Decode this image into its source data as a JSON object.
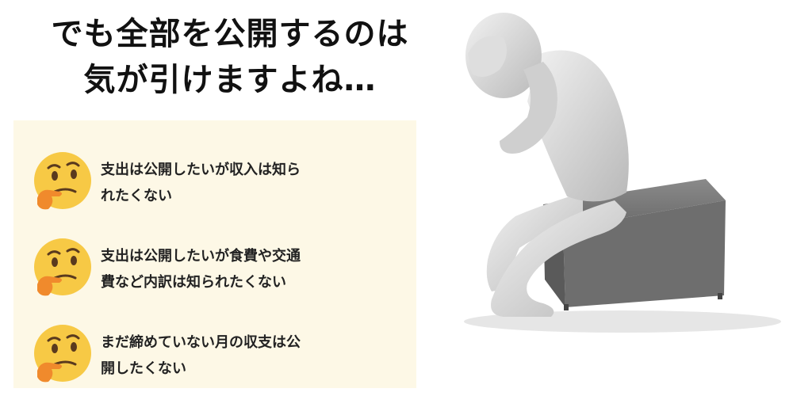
{
  "heading": {
    "line1": "でも全部を公開するのは",
    "line2": "気が引けますよね…"
  },
  "concerns": [
    {
      "icon": "thinking-face-emoji",
      "line1": "支出は公開したいが収入は知ら",
      "line2": "れたくない"
    },
    {
      "icon": "thinking-face-emoji",
      "line1": "支出は公開したいが食費や交通",
      "line2": "費など内訳は知られたくない"
    },
    {
      "icon": "thinking-face-emoji",
      "line1": "まだ締めていない月の収支は公",
      "line2": "開したくない"
    }
  ],
  "illustration": {
    "icon": "troubled-person-on-cube",
    "colors": {
      "figure": "#d9d9d9",
      "cube": "#6e6e6e"
    }
  },
  "colors": {
    "panel": "#fdf8e6",
    "emoji": "#f7c945",
    "hand": "#f08a2c"
  }
}
